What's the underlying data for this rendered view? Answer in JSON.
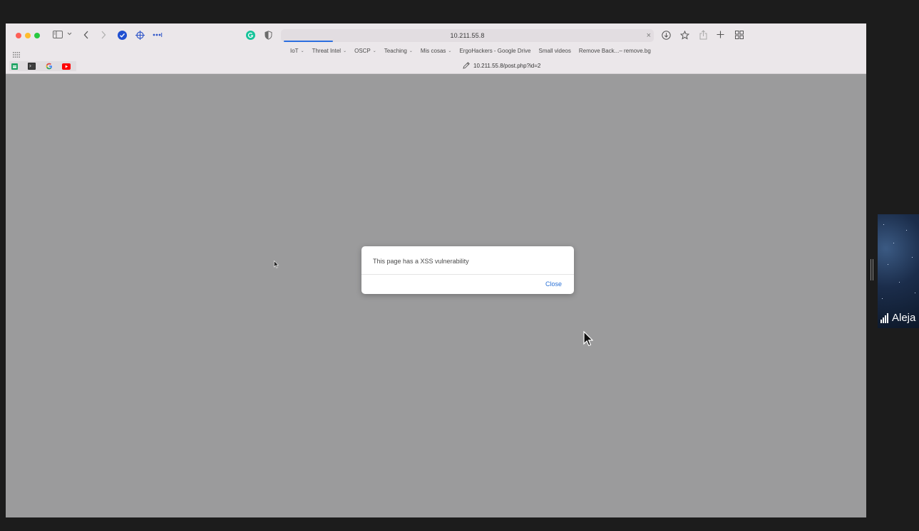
{
  "browser": {
    "url": "10.211.55.8",
    "bookmarks": [
      {
        "label": "IoT",
        "folder": true
      },
      {
        "label": "Threat Intel",
        "folder": true
      },
      {
        "label": "OSCP",
        "folder": true
      },
      {
        "label": "Teaching",
        "folder": true
      },
      {
        "label": "Mis cosas",
        "folder": true
      },
      {
        "label": "ErgoHackers - Google Drive",
        "folder": false
      },
      {
        "label": "Small videos",
        "folder": false
      },
      {
        "label": "Remove Back...– remove.bg",
        "folder": false
      }
    ],
    "active_tab": "10.211.55.8/post.php?id=2",
    "pinned_tabs": [
      "sheets-icon",
      "terminal-icon",
      "google-icon",
      "youtube-icon"
    ]
  },
  "dialog": {
    "message": "This page has a XSS vulnerability",
    "close_label": "Close"
  },
  "participant": {
    "name": "Aleja"
  },
  "colors": {
    "page_overlay": "#9b9b9c",
    "link_blue": "#2a71d6",
    "traffic_red": "#fe5f57",
    "traffic_yellow": "#febc2e",
    "traffic_green": "#28c840"
  }
}
